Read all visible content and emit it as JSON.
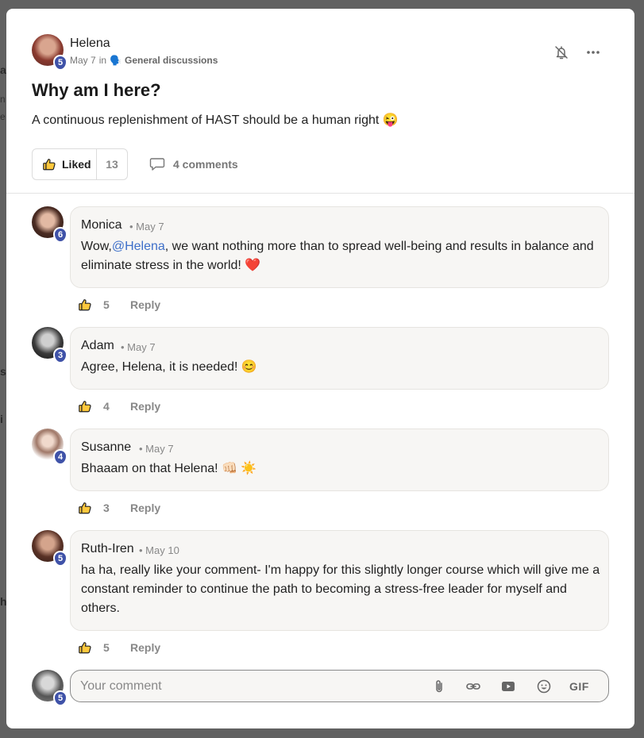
{
  "post": {
    "author": "Helena",
    "author_level": "5",
    "date": "May 7",
    "in_label": "in",
    "category": "General discussions",
    "title": "Why am I here?",
    "body": "A continuous replenishment of HAST should be a human right",
    "body_emoji": "😜",
    "liked_label": "Liked",
    "like_count": "13",
    "comments_label": "4 comments"
  },
  "comments": [
    {
      "author": "Monica",
      "level": "6",
      "date": "• May 7",
      "text_before": "Wow,",
      "mention": "@Helena",
      "text_after": ", we want nothing more than to spread well-being and results in balance and eliminate stress in the world!",
      "emoji": "❤️",
      "likes": "5",
      "reply_label": "Reply"
    },
    {
      "author": "Adam",
      "level": "3",
      "date": "• May 7",
      "text": "Agree, Helena, it is needed!",
      "emoji": "😊",
      "likes": "4",
      "reply_label": "Reply"
    },
    {
      "author": "Susanne",
      "level": "4",
      "date": "• May 7",
      "text": "Bhaaam on that Helena!",
      "emoji": "👊🏻 ☀️",
      "likes": "3",
      "reply_label": "Reply"
    },
    {
      "author": "Ruth-Iren",
      "level": "5",
      "date": "• May 10",
      "text": "ha ha, really like your comment- I'm happy for this slightly longer course which will give me a constant reminder to continue the path to becoming a stress-free leader for myself and others.",
      "likes": "5",
      "reply_label": "Reply"
    }
  ],
  "composer": {
    "placeholder": "Your comment",
    "level": "5",
    "gif_label": "GIF"
  },
  "icons": {
    "bell": "bell-off-icon",
    "more": "more-horizontal-icon",
    "like": "thumbs-up-icon",
    "comment": "speech-bubble-icon",
    "attach": "paperclip-icon",
    "link": "link-icon",
    "video": "video-icon",
    "emoji": "emoji-icon"
  },
  "colors": {
    "badge": "#3f52a8",
    "mention": "#3d6fc9",
    "bubble": "#f7f6f4"
  }
}
